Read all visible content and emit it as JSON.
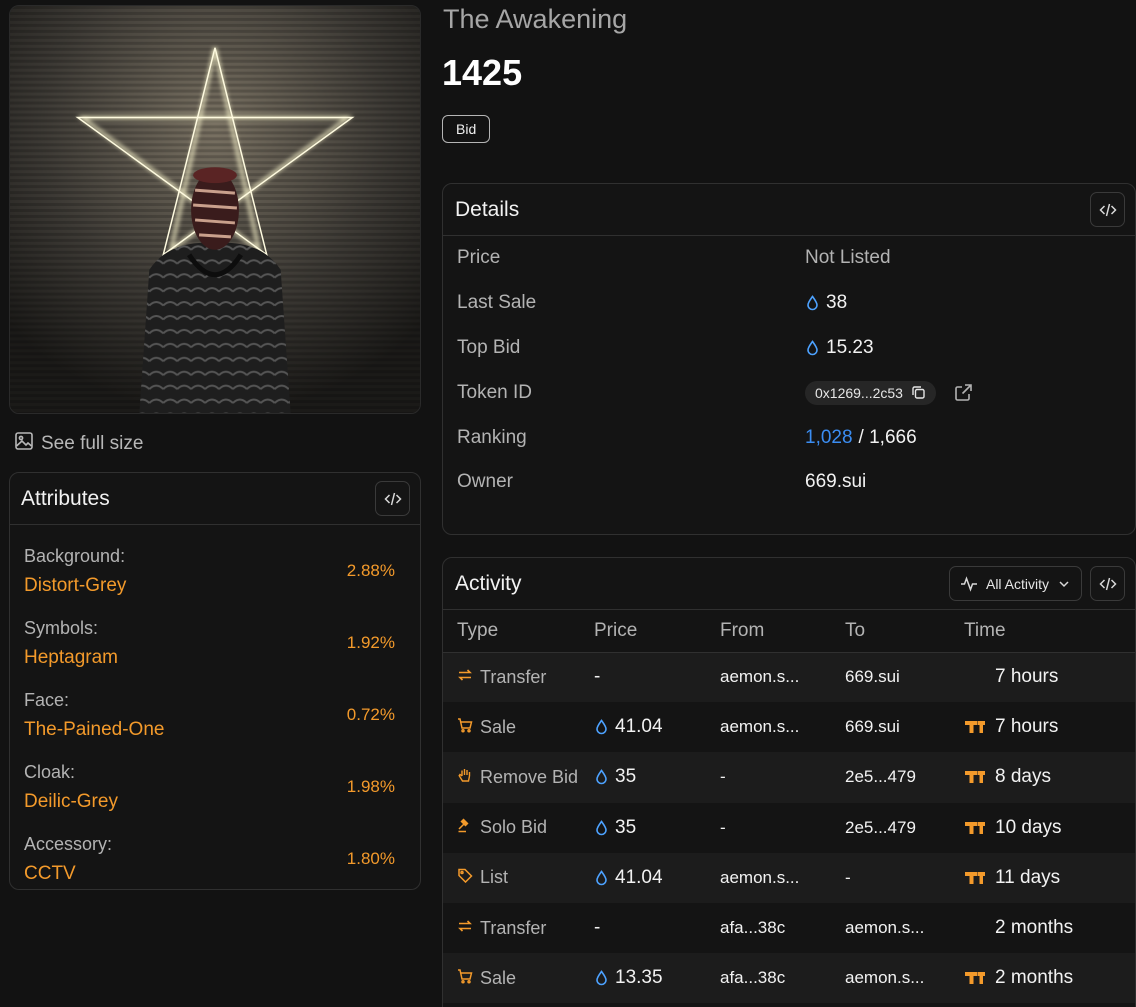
{
  "collection": {
    "name": "The Awakening"
  },
  "token": {
    "title": "1425",
    "bid_label": "Bid"
  },
  "image": {
    "alt": "NFT artwork: cloaked figure with wrapped face before a glowing heptagram",
    "see_full_label": "See full size"
  },
  "attributes": {
    "title": "Attributes",
    "items": [
      {
        "name": "Background:",
        "value": "Distort-Grey",
        "percent": "2.88%"
      },
      {
        "name": "Symbols:",
        "value": "Heptagram",
        "percent": "1.92%"
      },
      {
        "name": "Face:",
        "value": "The-Pained-One",
        "percent": "0.72%"
      },
      {
        "name": "Cloak:",
        "value": "Deilic-Grey",
        "percent": "1.98%"
      },
      {
        "name": "Accessory:",
        "value": "CCTV",
        "percent": "1.80%"
      }
    ]
  },
  "details": {
    "title": "Details",
    "price_label": "Price",
    "price_value": "Not Listed",
    "last_sale_label": "Last Sale",
    "last_sale_value": "38",
    "top_bid_label": "Top Bid",
    "top_bid_value": "15.23",
    "token_id_label": "Token ID",
    "token_id_value": "0x1269...2c53",
    "ranking_label": "Ranking",
    "ranking_value": "1,028",
    "ranking_total": "/ 1,666",
    "owner_label": "Owner",
    "owner_value": "669.sui"
  },
  "activity": {
    "title": "Activity",
    "filter_label": "All Activity",
    "columns": {
      "type": "Type",
      "price": "Price",
      "from": "From",
      "to": "To",
      "time": "Time"
    },
    "rows": [
      {
        "type": "Transfer",
        "icon": "transfer-icon",
        "price": "-",
        "from": "aemon.s...",
        "to": "669.sui",
        "time": "7 hours",
        "marketplace_icon": false
      },
      {
        "type": "Sale",
        "icon": "cart-icon",
        "price": "41.04",
        "from": "aemon.s...",
        "to": "669.sui",
        "time": "7 hours",
        "marketplace_icon": true
      },
      {
        "type": "Remove Bid",
        "icon": "hand-icon",
        "price": "35",
        "from": "-",
        "to": "2e5...479",
        "time": "8 days",
        "marketplace_icon": true
      },
      {
        "type": "Solo Bid",
        "icon": "gavel-icon",
        "price": "35",
        "from": "-",
        "to": "2e5...479",
        "time": "10 days",
        "marketplace_icon": true
      },
      {
        "type": "List",
        "icon": "tag-icon",
        "price": "41.04",
        "from": "aemon.s...",
        "to": "-",
        "time": "11 days",
        "marketplace_icon": true
      },
      {
        "type": "Transfer",
        "icon": "transfer-icon",
        "price": "-",
        "from": "afa...38c",
        "to": "aemon.s...",
        "time": "2 months",
        "marketplace_icon": false
      },
      {
        "type": "Sale",
        "icon": "cart-icon",
        "price": "13.35",
        "from": "afa...38c",
        "to": "aemon.s...",
        "time": "2 months",
        "marketplace_icon": true
      }
    ]
  },
  "colors": {
    "accent_orange": "#f39a2b",
    "link_blue": "#3b8df2",
    "sui_drop": "#4da2ff",
    "background": "#121212"
  }
}
